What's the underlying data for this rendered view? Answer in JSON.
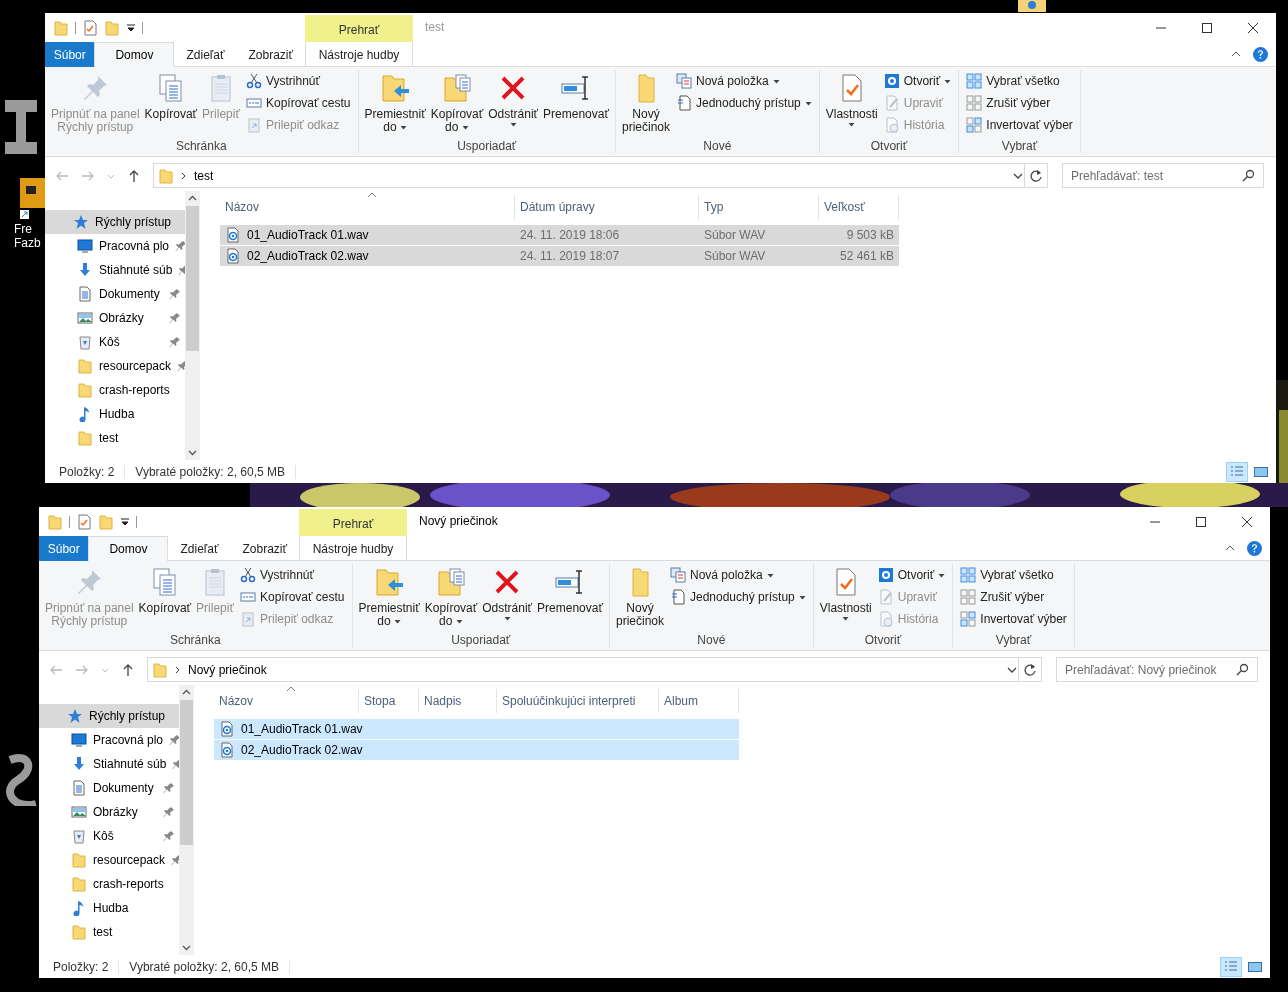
{
  "desktop_icon": {
    "label": "Fre\nFazb"
  },
  "windows": [
    {
      "active": false,
      "title": "test",
      "contextual_tab": "Prehrať",
      "tabs": [
        {
          "label": "Súbor",
          "kind": "file",
          "selected": false
        },
        {
          "label": "Domov",
          "kind": "tab",
          "selected": true
        },
        {
          "label": "Zdieľať",
          "kind": "tab",
          "selected": false
        },
        {
          "label": "Zobraziť",
          "kind": "tab",
          "selected": false
        },
        {
          "label": "Nástroje hudby",
          "kind": "contextual",
          "selected": false
        }
      ],
      "ribbon": [
        {
          "label": "Schránka",
          "large": [
            {
              "kind": "pin",
              "lines": [
                "Pripnúť na panel",
                "Rýchly prístup"
              ],
              "disabled": true,
              "dropdown": false
            },
            {
              "kind": "copy",
              "lines": [
                "Kopírovať"
              ],
              "disabled": false,
              "dropdown": false
            },
            {
              "kind": "paste",
              "lines": [
                "Prilepiť"
              ],
              "disabled": true,
              "dropdown": false
            }
          ],
          "small": [
            {
              "kind": "cut",
              "label": "Vystrihnúť",
              "disabled": false,
              "dropdown": false
            },
            {
              "kind": "copypath",
              "label": "Kopírovať cestu",
              "disabled": false,
              "dropdown": false
            },
            {
              "kind": "pasteshortcut",
              "label": "Prilepiť odkaz",
              "disabled": true,
              "dropdown": false
            }
          ]
        },
        {
          "label": "Usporiadať",
          "large": [
            {
              "kind": "moveto",
              "lines": [
                "Premiestniť",
                "do"
              ],
              "disabled": false,
              "dropdown": true
            },
            {
              "kind": "copyto",
              "lines": [
                "Kopírovať",
                "do"
              ],
              "disabled": false,
              "dropdown": true
            },
            {
              "kind": "delete",
              "lines": [
                "Odstrániť"
              ],
              "disabled": false,
              "dropdown": true
            },
            {
              "kind": "rename",
              "lines": [
                "Premenovať"
              ],
              "disabled": false,
              "dropdown": false
            }
          ]
        },
        {
          "label": "Nové",
          "large": [
            {
              "kind": "newfolder",
              "lines": [
                "Nový",
                "priečinok"
              ],
              "disabled": false,
              "dropdown": false
            }
          ],
          "small": [
            {
              "kind": "newitem",
              "label": "Nová položka",
              "disabled": false,
              "dropdown": true
            },
            {
              "kind": "easyaccess",
              "label": "Jednoduchý prístup",
              "disabled": false,
              "dropdown": true
            }
          ]
        },
        {
          "label": "Otvoriť",
          "large": [
            {
              "kind": "properties",
              "lines": [
                "Vlastnosti"
              ],
              "disabled": false,
              "dropdown": true
            }
          ],
          "small": [
            {
              "kind": "open",
              "label": "Otvoriť",
              "disabled": false,
              "dropdown": true
            },
            {
              "kind": "edit",
              "label": "Upraviť",
              "disabled": true,
              "dropdown": false
            },
            {
              "kind": "history",
              "label": "História",
              "disabled": true,
              "dropdown": false
            }
          ]
        },
        {
          "label": "Vybrať",
          "small": [
            {
              "kind": "selectall",
              "label": "Vybrať všetko",
              "disabled": false,
              "dropdown": false
            },
            {
              "kind": "selectnone",
              "label": "Zrušiť výber",
              "disabled": false,
              "dropdown": false
            },
            {
              "kind": "invert",
              "label": "Invertovať výber",
              "disabled": false,
              "dropdown": false
            }
          ]
        }
      ],
      "address": {
        "path": "test"
      },
      "search": {
        "placeholder": "Prehľadávať: test"
      },
      "nav": [
        {
          "label": "Rýchly prístup",
          "kind": "star",
          "selected": true,
          "pinned": false,
          "children": [
            {
              "label": "Pracovná plo",
              "kind": "desktop",
              "selected": false,
              "pinned": true
            },
            {
              "label": "Stiahnuté súb",
              "kind": "download",
              "selected": false,
              "pinned": true
            },
            {
              "label": "Dokumenty",
              "kind": "document",
              "selected": false,
              "pinned": true
            },
            {
              "label": "Obrázky",
              "kind": "picture",
              "selected": false,
              "pinned": true
            },
            {
              "label": "Kôš",
              "kind": "recycle",
              "selected": false,
              "pinned": true
            },
            {
              "label": "resourcepack",
              "kind": "folder",
              "selected": false,
              "pinned": true
            },
            {
              "label": "crash-reports",
              "kind": "folder",
              "selected": false,
              "pinned": false
            },
            {
              "label": "Hudba",
              "kind": "music",
              "selected": false,
              "pinned": false
            },
            {
              "label": "test",
              "kind": "folder",
              "selected": false,
              "pinned": false
            }
          ]
        }
      ],
      "columns": [
        {
          "label": "Názov",
          "kind": "text",
          "sorted": true
        },
        {
          "label": "Dátum úpravy",
          "kind": "text",
          "sorted": false
        },
        {
          "label": "Typ",
          "kind": "text",
          "sorted": false
        },
        {
          "label": "Veľkosť",
          "kind": "number",
          "sorted": false
        }
      ],
      "rows": [
        {
          "selected": true,
          "cells": [
            "01_AudioTrack 01.wav",
            "24. 11. 2019 18:06",
            "Súbor WAV",
            "9 503 kB"
          ]
        },
        {
          "selected": true,
          "cells": [
            "02_AudioTrack 02.wav",
            "24. 11. 2019 18:07",
            "Súbor WAV",
            "52 461 kB"
          ]
        }
      ],
      "status": [
        "Položky: 2",
        "Vybraté položky: 2, 60,5 MB"
      ],
      "views": [
        {
          "kind": "details",
          "selected": true
        },
        {
          "kind": "tiles",
          "selected": false
        }
      ]
    },
    {
      "active": true,
      "title": "Nový priečinok",
      "contextual_tab": "Prehrať",
      "tabs": [
        {
          "label": "Súbor",
          "kind": "file",
          "selected": false
        },
        {
          "label": "Domov",
          "kind": "tab",
          "selected": true
        },
        {
          "label": "Zdieľať",
          "kind": "tab",
          "selected": false
        },
        {
          "label": "Zobraziť",
          "kind": "tab",
          "selected": false
        },
        {
          "label": "Nástroje hudby",
          "kind": "contextual",
          "selected": false
        }
      ],
      "ribbon": [
        {
          "label": "Schránka",
          "large": [
            {
              "kind": "pin",
              "lines": [
                "Pripnúť na panel",
                "Rýchly prístup"
              ],
              "disabled": true,
              "dropdown": false
            },
            {
              "kind": "copy",
              "lines": [
                "Kopírovať"
              ],
              "disabled": false,
              "dropdown": false
            },
            {
              "kind": "paste",
              "lines": [
                "Prilepiť"
              ],
              "disabled": true,
              "dropdown": false
            }
          ],
          "small": [
            {
              "kind": "cut",
              "label": "Vystrihnúť",
              "disabled": false,
              "dropdown": false
            },
            {
              "kind": "copypath",
              "label": "Kopírovať cestu",
              "disabled": false,
              "dropdown": false
            },
            {
              "kind": "pasteshortcut",
              "label": "Prilepiť odkaz",
              "disabled": true,
              "dropdown": false
            }
          ]
        },
        {
          "label": "Usporiadať",
          "large": [
            {
              "kind": "moveto",
              "lines": [
                "Premiestniť",
                "do"
              ],
              "disabled": false,
              "dropdown": true
            },
            {
              "kind": "copyto",
              "lines": [
                "Kopírovať",
                "do"
              ],
              "disabled": false,
              "dropdown": true
            },
            {
              "kind": "delete",
              "lines": [
                "Odstrániť"
              ],
              "disabled": false,
              "dropdown": true
            },
            {
              "kind": "rename",
              "lines": [
                "Premenovať"
              ],
              "disabled": false,
              "dropdown": false
            }
          ]
        },
        {
          "label": "Nové",
          "large": [
            {
              "kind": "newfolder",
              "lines": [
                "Nový",
                "priečinok"
              ],
              "disabled": false,
              "dropdown": false
            }
          ],
          "small": [
            {
              "kind": "newitem",
              "label": "Nová položka",
              "disabled": false,
              "dropdown": true
            },
            {
              "kind": "easyaccess",
              "label": "Jednoduchý prístup",
              "disabled": false,
              "dropdown": true
            }
          ]
        },
        {
          "label": "Otvoriť",
          "large": [
            {
              "kind": "properties",
              "lines": [
                "Vlastnosti"
              ],
              "disabled": false,
              "dropdown": true
            }
          ],
          "small": [
            {
              "kind": "open",
              "label": "Otvoriť",
              "disabled": false,
              "dropdown": true
            },
            {
              "kind": "edit",
              "label": "Upraviť",
              "disabled": true,
              "dropdown": false
            },
            {
              "kind": "history",
              "label": "História",
              "disabled": true,
              "dropdown": false
            }
          ]
        },
        {
          "label": "Vybrať",
          "small": [
            {
              "kind": "selectall",
              "label": "Vybrať všetko",
              "disabled": false,
              "dropdown": false
            },
            {
              "kind": "selectnone",
              "label": "Zrušiť výber",
              "disabled": false,
              "dropdown": false
            },
            {
              "kind": "invert",
              "label": "Invertovať výber",
              "disabled": false,
              "dropdown": false
            }
          ]
        }
      ],
      "address": {
        "path": "Nový priečinok"
      },
      "search": {
        "placeholder": "Prehľadávať: Nový priečinok"
      },
      "nav": [
        {
          "label": "Rýchly prístup",
          "kind": "star",
          "selected": true,
          "pinned": false,
          "children": [
            {
              "label": "Pracovná plo",
              "kind": "desktop",
              "selected": false,
              "pinned": true
            },
            {
              "label": "Stiahnuté súb",
              "kind": "download",
              "selected": false,
              "pinned": true
            },
            {
              "label": "Dokumenty",
              "kind": "document",
              "selected": false,
              "pinned": true
            },
            {
              "label": "Obrázky",
              "kind": "picture",
              "selected": false,
              "pinned": true
            },
            {
              "label": "Kôš",
              "kind": "recycle",
              "selected": false,
              "pinned": true
            },
            {
              "label": "resourcepack",
              "kind": "folder",
              "selected": false,
              "pinned": true
            },
            {
              "label": "crash-reports",
              "kind": "folder",
              "selected": false,
              "pinned": false
            },
            {
              "label": "Hudba",
              "kind": "music",
              "selected": false,
              "pinned": false
            },
            {
              "label": "test",
              "kind": "folder",
              "selected": false,
              "pinned": false
            }
          ]
        }
      ],
      "columns": [
        {
          "label": "Názov",
          "sorted": true
        },
        {
          "label": "Stopa",
          "sorted": false
        },
        {
          "label": "Nadpis",
          "sorted": false
        },
        {
          "label": "Spoluúčinkujúci interpreti",
          "sorted": false
        },
        {
          "label": "Album",
          "sorted": false
        }
      ],
      "rows": [
        {
          "selected": true,
          "cells": [
            "01_AudioTrack 01.wav"
          ]
        },
        {
          "selected": true,
          "cells": [
            "02_AudioTrack 02.wav"
          ]
        }
      ],
      "status": [
        "Položky: 2",
        "Vybraté položky: 2, 60,5 MB"
      ],
      "views": [
        {
          "kind": "details",
          "selected": true
        },
        {
          "kind": "tiles",
          "selected": false
        }
      ]
    }
  ]
}
